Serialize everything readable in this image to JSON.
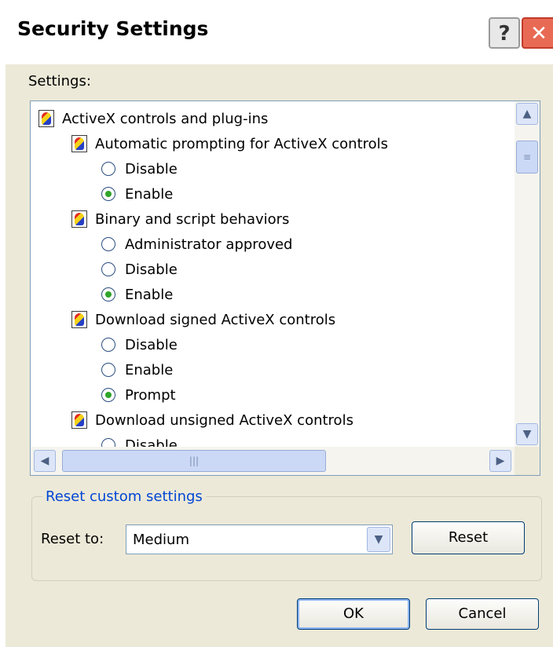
{
  "window": {
    "title": "Security Settings",
    "help_glyph": "?",
    "close_glyph": "✕"
  },
  "settings_label": "Settings:",
  "tree": {
    "rows": [
      {
        "kind": "category",
        "label": "ActiveX controls and plug-ins",
        "level": 0
      },
      {
        "kind": "category",
        "label": "Automatic prompting for ActiveX controls",
        "level": 1
      },
      {
        "kind": "option",
        "label": "Disable",
        "level": 2,
        "checked": false
      },
      {
        "kind": "option",
        "label": "Enable",
        "level": 2,
        "checked": true
      },
      {
        "kind": "category",
        "label": "Binary and script behaviors",
        "level": 1
      },
      {
        "kind": "option",
        "label": "Administrator approved",
        "level": 2,
        "checked": false
      },
      {
        "kind": "option",
        "label": "Disable",
        "level": 2,
        "checked": false
      },
      {
        "kind": "option",
        "label": "Enable",
        "level": 2,
        "checked": true
      },
      {
        "kind": "category",
        "label": "Download signed ActiveX controls",
        "level": 1
      },
      {
        "kind": "option",
        "label": "Disable",
        "level": 2,
        "checked": false
      },
      {
        "kind": "option",
        "label": "Enable",
        "level": 2,
        "checked": false
      },
      {
        "kind": "option",
        "label": "Prompt",
        "level": 2,
        "checked": true
      },
      {
        "kind": "category",
        "label": "Download unsigned ActiveX controls",
        "level": 1
      },
      {
        "kind": "option",
        "label": "Disable",
        "level": 2,
        "checked": false
      }
    ],
    "scroll_up_glyph": "▲",
    "scroll_down_glyph": "▼",
    "scroll_left_glyph": "◀",
    "scroll_right_glyph": "▶",
    "grip_v": "≡",
    "grip_h": "|||"
  },
  "reset_group": {
    "legend": "Reset custom settings",
    "reset_to_label": "Reset to:",
    "selected": "Medium",
    "arrow_glyph": "▼",
    "reset_button": "Reset"
  },
  "buttons": {
    "ok": "OK",
    "cancel": "Cancel"
  }
}
